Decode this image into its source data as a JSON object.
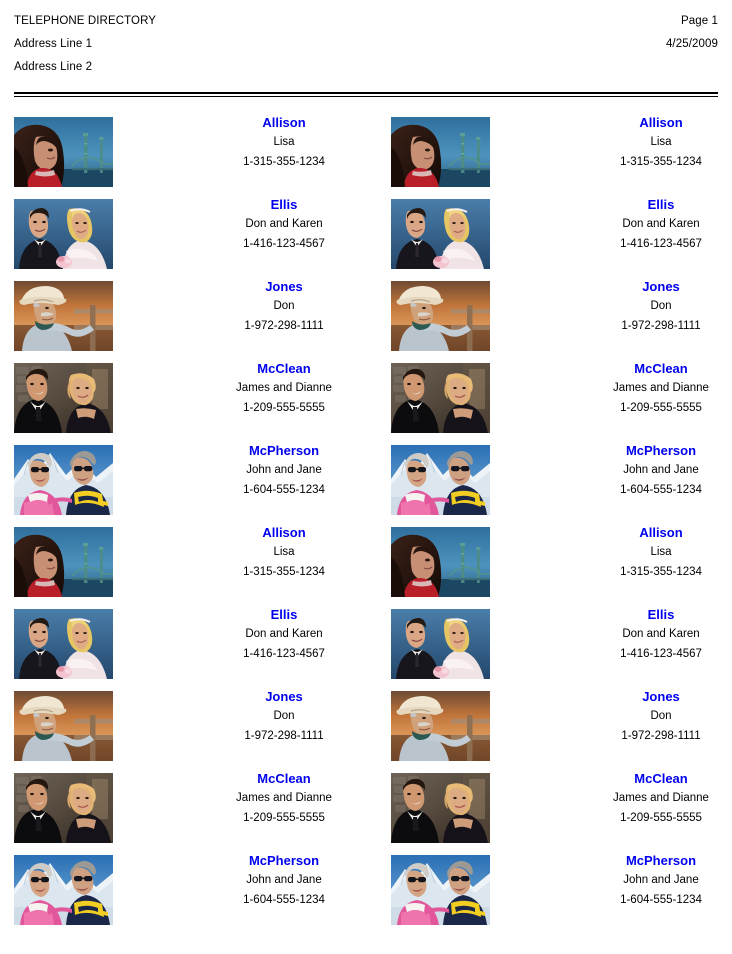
{
  "header": {
    "title": "TELEPHONE DIRECTORY",
    "address_line_1": "Address Line 1",
    "address_line_2": "Address Line 2",
    "page_label": "Page 1",
    "date": "4/25/2009"
  },
  "colors": {
    "last_name": "#0000ee",
    "text": "#000000",
    "rule": "#000000",
    "background": "#ffffff"
  },
  "entries": [
    {
      "last": "Allison",
      "first": "Lisa",
      "phone": "1-315-355-1234",
      "photo": "woman-bridge-photo"
    },
    {
      "last": "Ellis",
      "first": "Don and Karen",
      "phone": "1-416-123-4567",
      "photo": "wedding-couple-photo"
    },
    {
      "last": "Jones",
      "first": "Don",
      "phone": "1-972-298-1111",
      "photo": "cowboy-photo"
    },
    {
      "last": "McClean",
      "first": "James and Dianne",
      "phone": "1-209-555-5555",
      "photo": "tuxedo-couple-photo"
    },
    {
      "last": "McPherson",
      "first": "John and Jane",
      "phone": "1-604-555-1234",
      "photo": "ski-couple-photo"
    },
    {
      "last": "Allison",
      "first": "Lisa",
      "phone": "1-315-355-1234",
      "photo": "woman-bridge-photo"
    },
    {
      "last": "Ellis",
      "first": "Don and Karen",
      "phone": "1-416-123-4567",
      "photo": "wedding-couple-photo"
    },
    {
      "last": "Jones",
      "first": "Don",
      "phone": "1-972-298-1111",
      "photo": "cowboy-photo"
    },
    {
      "last": "McClean",
      "first": "James and Dianne",
      "phone": "1-209-555-5555",
      "photo": "tuxedo-couple-photo"
    },
    {
      "last": "McPherson",
      "first": "John and Jane",
      "phone": "1-604-555-1234",
      "photo": "ski-couple-photo"
    }
  ]
}
